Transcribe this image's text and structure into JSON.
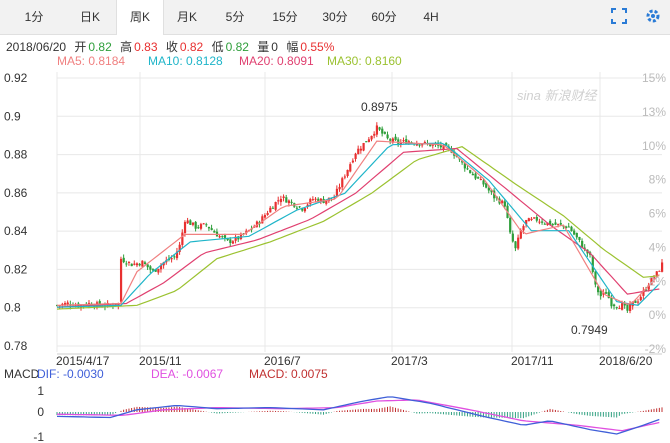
{
  "tabs": [
    {
      "label": "1分",
      "active": false
    },
    {
      "label": "日K",
      "active": false
    },
    {
      "label": "周K",
      "active": true
    },
    {
      "label": "月K",
      "active": false
    },
    {
      "label": "5分",
      "active": false
    },
    {
      "label": "15分",
      "active": false
    },
    {
      "label": "30分",
      "active": false
    },
    {
      "label": "60分",
      "active": false
    },
    {
      "label": "4H",
      "active": false
    }
  ],
  "toolbar_icons": [
    "fullscreen-icon",
    "settings-icon"
  ],
  "info": {
    "date": "2018/06/20",
    "open_label": "开",
    "open": "0.82",
    "high_label": "高",
    "high": "0.83",
    "close_label": "收",
    "close": "0.82",
    "low_label": "低",
    "low": "0.82",
    "volume_label": "量",
    "volume": "0",
    "change_label": "幅",
    "change": "0.55%"
  },
  "ma": {
    "ma5": "MA5: 0.8184",
    "ma10": "MA10: 0.8128",
    "ma20": "MA20: 0.8091",
    "ma30": "MA30: 0.8160"
  },
  "macd": {
    "title": "MACD",
    "dif": "DIF: -0.0030",
    "dea": "DEA: -0.0067",
    "macd": "MACD: 0.0075"
  },
  "watermark": "sina 新浪财经",
  "colors": {
    "up": "#e83030",
    "down": "#2e9e3a",
    "ma5": "#f08080",
    "ma10": "#1fb5c9",
    "ma20": "#e04070",
    "ma30": "#9bc230",
    "dif": "#3f5fd8",
    "dea": "#e050e0",
    "macd_pos": "#c03030",
    "macd_neg": "#30a080",
    "grid": "#e8e8e8"
  },
  "chart_data": {
    "type": "candlestick",
    "y_ticks_left": [
      "0.92",
      "0.9",
      "0.88",
      "0.86",
      "0.84",
      "0.82",
      "0.8",
      "0.78"
    ],
    "y_ticks_right": [
      "15%",
      "13%",
      "10%",
      "8%",
      "6%",
      "4%",
      "2%",
      "0%",
      "-2%"
    ],
    "x_ticks": [
      "2015/4/17",
      "2015/11",
      "2016/7",
      "2017/3",
      "2017/11",
      "2018/6/20"
    ],
    "ylim": [
      0.775,
      0.925
    ],
    "annotations": {
      "high": "0.8975",
      "low": "0.7949"
    },
    "macd_ticks": [
      "1",
      "0",
      "-1"
    ],
    "price_path": [
      [
        0,
        0.8
      ],
      [
        4,
        0.801
      ],
      [
        8,
        0.8
      ],
      [
        12,
        0.801
      ],
      [
        16,
        0.8
      ],
      [
        20,
        0.8
      ],
      [
        23,
        0.801
      ],
      [
        24,
        0.825
      ],
      [
        28,
        0.822
      ],
      [
        32,
        0.823
      ],
      [
        36,
        0.818
      ],
      [
        40,
        0.823
      ],
      [
        44,
        0.826
      ],
      [
        46,
        0.832
      ],
      [
        48,
        0.846
      ],
      [
        52,
        0.842
      ],
      [
        56,
        0.843
      ],
      [
        60,
        0.838
      ],
      [
        64,
        0.834
      ],
      [
        68,
        0.836
      ],
      [
        72,
        0.84
      ],
      [
        76,
        0.845
      ],
      [
        80,
        0.852
      ],
      [
        84,
        0.858
      ],
      [
        88,
        0.855
      ],
      [
        92,
        0.852
      ],
      [
        96,
        0.857
      ],
      [
        100,
        0.856
      ],
      [
        104,
        0.858
      ],
      [
        108,
        0.87
      ],
      [
        112,
        0.882
      ],
      [
        116,
        0.888
      ],
      [
        120,
        0.895
      ],
      [
        124,
        0.889
      ],
      [
        128,
        0.887
      ],
      [
        132,
        0.888
      ],
      [
        136,
        0.887
      ],
      [
        140,
        0.886
      ],
      [
        144,
        0.885
      ],
      [
        148,
        0.883
      ],
      [
        152,
        0.876
      ],
      [
        156,
        0.87
      ],
      [
        160,
        0.865
      ],
      [
        164,
        0.858
      ],
      [
        168,
        0.854
      ],
      [
        170,
        0.838
      ],
      [
        172,
        0.83
      ],
      [
        174,
        0.84
      ],
      [
        176,
        0.845
      ],
      [
        180,
        0.846
      ],
      [
        184,
        0.844
      ],
      [
        188,
        0.843
      ],
      [
        192,
        0.842
      ],
      [
        196,
        0.834
      ],
      [
        200,
        0.826
      ],
      [
        202,
        0.81
      ],
      [
        204,
        0.805
      ],
      [
        206,
        0.807
      ],
      [
        208,
        0.801
      ],
      [
        210,
        0.8
      ],
      [
        212,
        0.8
      ],
      [
        214,
        0.797
      ],
      [
        216,
        0.801
      ],
      [
        218,
        0.803
      ],
      [
        220,
        0.807
      ],
      [
        222,
        0.812
      ],
      [
        225,
        0.817
      ],
      [
        227,
        0.822
      ]
    ],
    "ma_paths": {
      "ma5": [
        [
          0,
          0.8
        ],
        [
          24,
          0.801
        ],
        [
          30,
          0.818
        ],
        [
          48,
          0.838
        ],
        [
          70,
          0.838
        ],
        [
          85,
          0.853
        ],
        [
          105,
          0.857
        ],
        [
          120,
          0.888
        ],
        [
          145,
          0.886
        ],
        [
          160,
          0.868
        ],
        [
          175,
          0.838
        ],
        [
          190,
          0.843
        ],
        [
          205,
          0.806
        ],
        [
          215,
          0.8
        ],
        [
          227,
          0.818
        ]
      ],
      "ma10": [
        [
          0,
          0.799
        ],
        [
          24,
          0.8
        ],
        [
          35,
          0.817
        ],
        [
          50,
          0.834
        ],
        [
          72,
          0.837
        ],
        [
          90,
          0.851
        ],
        [
          108,
          0.86
        ],
        [
          125,
          0.886
        ],
        [
          145,
          0.887
        ],
        [
          162,
          0.867
        ],
        [
          178,
          0.84
        ],
        [
          192,
          0.84
        ],
        [
          210,
          0.802
        ],
        [
          218,
          0.8
        ],
        [
          227,
          0.813
        ]
      ],
      "ma20": [
        [
          0,
          0.799
        ],
        [
          26,
          0.801
        ],
        [
          40,
          0.812
        ],
        [
          55,
          0.828
        ],
        [
          75,
          0.835
        ],
        [
          95,
          0.846
        ],
        [
          112,
          0.86
        ],
        [
          130,
          0.882
        ],
        [
          150,
          0.884
        ],
        [
          168,
          0.863
        ],
        [
          185,
          0.843
        ],
        [
          200,
          0.828
        ],
        [
          214,
          0.806
        ],
        [
          227,
          0.809
        ]
      ],
      "ma30": [
        [
          0,
          0.798
        ],
        [
          30,
          0.8
        ],
        [
          45,
          0.808
        ],
        [
          60,
          0.825
        ],
        [
          80,
          0.834
        ],
        [
          100,
          0.845
        ],
        [
          118,
          0.86
        ],
        [
          135,
          0.878
        ],
        [
          152,
          0.885
        ],
        [
          172,
          0.865
        ],
        [
          190,
          0.848
        ],
        [
          205,
          0.83
        ],
        [
          220,
          0.815
        ],
        [
          227,
          0.816
        ]
      ]
    },
    "dif_path": [
      [
        0,
        -0.2
      ],
      [
        20,
        -0.25
      ],
      [
        30,
        0.1
      ],
      [
        45,
        0.3
      ],
      [
        60,
        0.15
      ],
      [
        80,
        0.2
      ],
      [
        100,
        0.1
      ],
      [
        115,
        0.5
      ],
      [
        125,
        0.7
      ],
      [
        140,
        0.4
      ],
      [
        160,
        -0.2
      ],
      [
        175,
        -0.6
      ],
      [
        185,
        -0.4
      ],
      [
        200,
        -0.8
      ],
      [
        210,
        -1.0
      ],
      [
        220,
        -0.6
      ],
      [
        227,
        -0.3
      ]
    ],
    "dea_path": [
      [
        0,
        -0.1
      ],
      [
        25,
        -0.15
      ],
      [
        40,
        0.1
      ],
      [
        60,
        0.2
      ],
      [
        85,
        0.15
      ],
      [
        105,
        0.2
      ],
      [
        120,
        0.5
      ],
      [
        135,
        0.55
      ],
      [
        155,
        0.1
      ],
      [
        175,
        -0.4
      ],
      [
        195,
        -0.6
      ],
      [
        212,
        -0.85
      ],
      [
        227,
        -0.45
      ]
    ]
  }
}
